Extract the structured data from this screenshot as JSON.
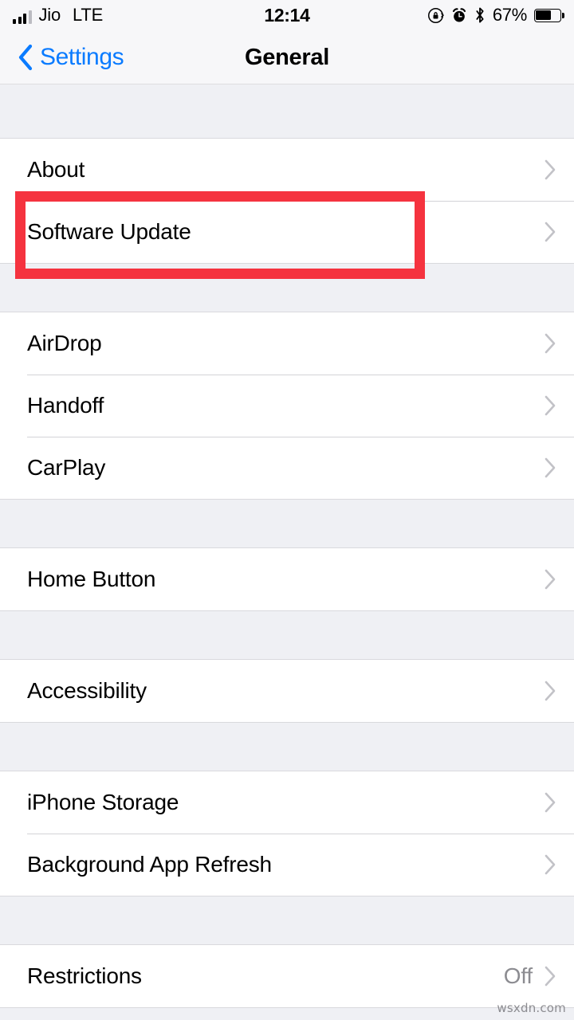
{
  "status_bar": {
    "signal_icon": "cellular-signal-bars-icon",
    "signal_bars_filled": 3,
    "signal_bars_total": 4,
    "carrier": "Jio",
    "network_type": "LTE",
    "time": "12:14",
    "rotation_lock_icon": "rotation-lock-icon",
    "alarm_icon": "alarm-clock-icon",
    "bluetooth_icon": "bluetooth-icon",
    "battery_percent": "67%",
    "battery_level": 67,
    "battery_icon": "battery-icon"
  },
  "nav_bar": {
    "back_icon": "chevron-left-icon",
    "back_label": "Settings",
    "title": "General"
  },
  "annotation": {
    "highlight_target": "Software Update",
    "color": "#f5333f"
  },
  "colors": {
    "accent_blue": "#0a7bff",
    "group_background": "#ffffff",
    "page_background": "#eff0f4",
    "separator": "#d3d3d7",
    "chevron": "#c2c2c7",
    "secondary_text": "#8c8c91",
    "highlight_red": "#f5333f"
  },
  "chevron_icon": "chevron-right-icon",
  "groups": [
    {
      "rows": [
        {
          "label": "About",
          "value": "",
          "name": "about"
        },
        {
          "label": "Software Update",
          "value": "",
          "name": "software-update"
        }
      ]
    },
    {
      "rows": [
        {
          "label": "AirDrop",
          "value": "",
          "name": "airdrop"
        },
        {
          "label": "Handoff",
          "value": "",
          "name": "handoff"
        },
        {
          "label": "CarPlay",
          "value": "",
          "name": "carplay"
        }
      ]
    },
    {
      "rows": [
        {
          "label": "Home Button",
          "value": "",
          "name": "home-button"
        }
      ]
    },
    {
      "rows": [
        {
          "label": "Accessibility",
          "value": "",
          "name": "accessibility"
        }
      ]
    },
    {
      "rows": [
        {
          "label": "iPhone Storage",
          "value": "",
          "name": "iphone-storage"
        },
        {
          "label": "Background App Refresh",
          "value": "",
          "name": "background-app-refresh"
        }
      ]
    },
    {
      "rows": [
        {
          "label": "Restrictions",
          "value": "Off",
          "name": "restrictions"
        }
      ]
    }
  ],
  "watermark": "wsxdn.com"
}
